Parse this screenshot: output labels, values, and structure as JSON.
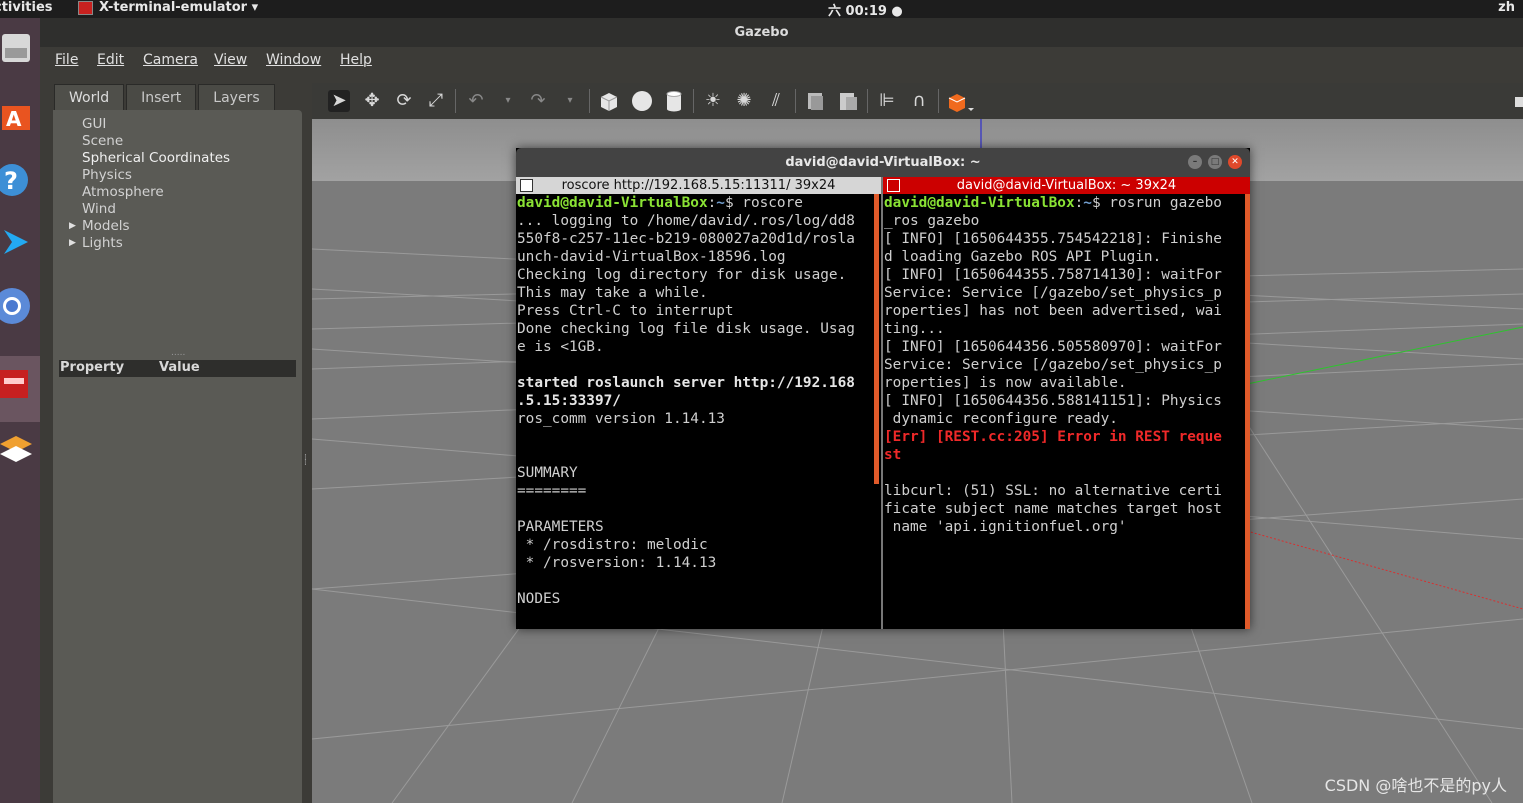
{
  "topbar": {
    "activities": "ctivities",
    "app_name": "X-terminal-emulator ▾",
    "clock": "六 00:19 ●",
    "lang": "zh"
  },
  "window": {
    "title": "Gazebo"
  },
  "menu": [
    "File",
    "Edit",
    "Camera",
    "View",
    "Window",
    "Help"
  ],
  "tabs": [
    "World",
    "Insert",
    "Layers"
  ],
  "tree": {
    "items": [
      "GUI",
      "Scene",
      "Spherical Coordinates",
      "Physics",
      "Atmosphere",
      "Wind",
      "Models",
      "Lights"
    ]
  },
  "property_table": {
    "col1": "Property",
    "col2": "Value"
  },
  "toolbar_icons": [
    "select-icon",
    "translate-icon",
    "rotate-icon",
    "scale-icon",
    "undo-icon",
    "redo-icon",
    "box-icon",
    "sphere-icon",
    "cylinder-icon",
    "pointlight-icon",
    "spotlight-icon",
    "dirlight-icon",
    "copy-icon",
    "paste-icon",
    "align-icon",
    "snap-icon",
    "view-angle-icon"
  ],
  "terminal": {
    "title": "david@david-VirtualBox: ~",
    "left_header": "roscore http://192.168.5.15:11311/ 39x24",
    "right_header": "david@david-VirtualBox: ~ 39x24",
    "left": {
      "user": "david@david-VirtualBox",
      "sep": ":",
      "path": "~",
      "cmd": "$ roscore",
      "l1": "... logging to /home/david/.ros/log/dd8",
      "l2": "550f8-c257-11ec-b219-080027a20d1d/rosla",
      "l3": "unch-david-VirtualBox-18596.log",
      "l4": "Checking log directory for disk usage.",
      "l5": "This may take a while.",
      "l6": "Press Ctrl-C to interrupt",
      "l7": "Done checking log file disk usage. Usag",
      "l8": "e is <1GB.",
      "s1": "started roslaunch server http://192.168",
      "s2": ".5.15:33397/",
      "l9": "ros_comm version 1.14.13",
      "l10": "SUMMARY",
      "l11": "========",
      "l12": "PARAMETERS",
      "l13": " * /rosdistro: melodic",
      "l14": " * /rosversion: 1.14.13",
      "l15": "NODES"
    },
    "right": {
      "user": "david@david-VirtualBox",
      "sep": ":",
      "path": "~",
      "cmd": "$ rosrun gazebo",
      "r1": "_ros gazebo",
      "r2": "[ INFO] [1650644355.754542218]: Finishe",
      "r3": "d loading Gazebo ROS API Plugin.",
      "r4": "[ INFO] [1650644355.758714130]: waitFor",
      "r5": "Service: Service [/gazebo/set_physics_p",
      "r6": "roperties] has not been advertised, wai",
      "r7": "ting...",
      "r8": "[ INFO] [1650644356.505580970]: waitFor",
      "r9": "Service: Service [/gazebo/set_physics_p",
      "r10": "roperties] is now available.",
      "r11": "[ INFO] [1650644356.588141151]: Physics",
      "r12": " dynamic reconfigure ready.",
      "e1": "[Err] [REST.cc:205] Error in REST reque",
      "e2": "st",
      "r13": "libcurl: (51) SSL: no alternative certi",
      "r14": "ficate subject name matches target host",
      "r15": " name 'api.ignitionfuel.org'"
    }
  },
  "watermark": "CSDN @啥也不是的py人",
  "colors": {
    "terminal_user": "#8ae234",
    "terminal_path": "#729fcf",
    "terminal_err": "#ef2929",
    "active_pane_header": "#cc0000",
    "dock": "#4a3a44"
  }
}
